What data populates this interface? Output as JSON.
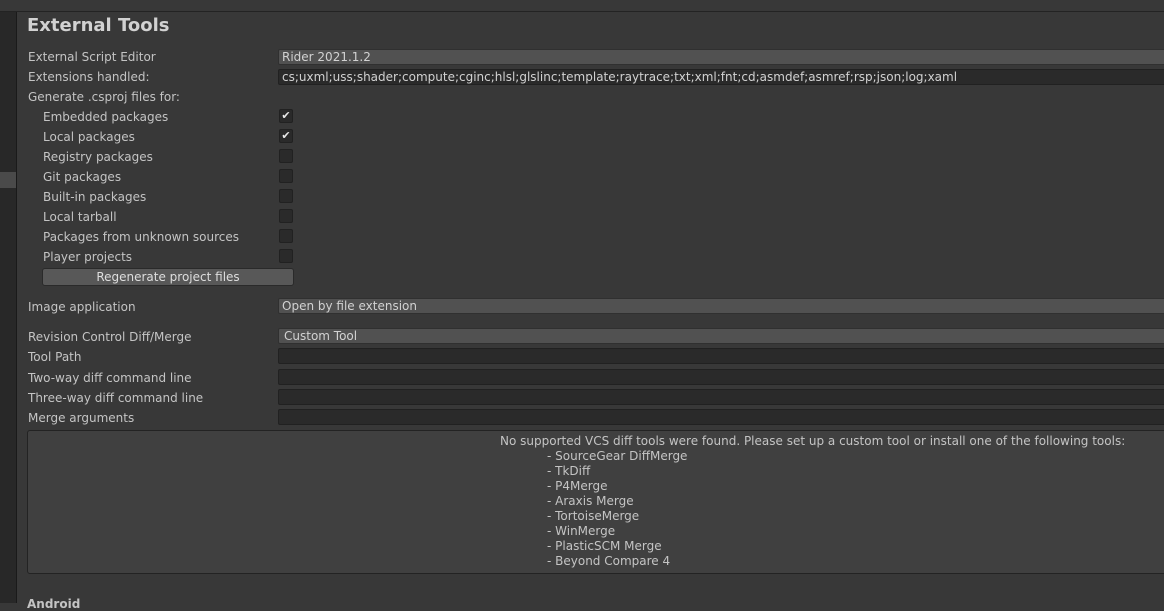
{
  "panel": {
    "title": "External Tools"
  },
  "script_editor": {
    "label": "External Script Editor",
    "value": "Rider 2021.1.2"
  },
  "extensions": {
    "label": "Extensions handled:",
    "value": "cs;uxml;uss;shader;compute;cginc;hlsl;glslinc;template;raytrace;txt;xml;fnt;cd;asmdef;asmref;rsp;json;log;xaml"
  },
  "csproj": {
    "label": "Generate .csproj files for:",
    "items": [
      {
        "label": "Embedded packages",
        "checked": "✔"
      },
      {
        "label": "Local packages",
        "checked": "✔"
      },
      {
        "label": "Registry packages",
        "checked": ""
      },
      {
        "label": "Git packages",
        "checked": ""
      },
      {
        "label": "Built-in packages",
        "checked": ""
      },
      {
        "label": "Local tarball",
        "checked": ""
      },
      {
        "label": "Packages from unknown sources",
        "checked": ""
      },
      {
        "label": "Player projects",
        "checked": ""
      }
    ],
    "regenerate_label": "Regenerate project files"
  },
  "image_app": {
    "label": "Image application",
    "value": "Open by file extension"
  },
  "revision": {
    "label": "Revision Control Diff/Merge",
    "value": "Custom Tool",
    "tool_path_label": "Tool Path",
    "tool_path_value": "",
    "two_way_label": "Two-way diff command line",
    "two_way_value": "",
    "three_way_label": "Three-way diff command line",
    "three_way_value": "",
    "merge_label": "Merge arguments",
    "merge_value": ""
  },
  "help": {
    "message": "No supported VCS diff tools were found. Please set up a custom tool or install one of the following tools:",
    "tools": [
      "- SourceGear DiffMerge",
      "- TkDiff",
      "- P4Merge",
      "- Araxis Merge",
      "- TortoiseMerge",
      "- WinMerge",
      "- PlasticSCM Merge",
      "- Beyond Compare 4"
    ]
  },
  "next_section": {
    "label": "Android"
  },
  "icons": {
    "checkmark": "check-icon"
  },
  "colors": {
    "background": "#383838",
    "field": "#2a2a2a",
    "dropdown": "#515151",
    "button": "#585858"
  }
}
